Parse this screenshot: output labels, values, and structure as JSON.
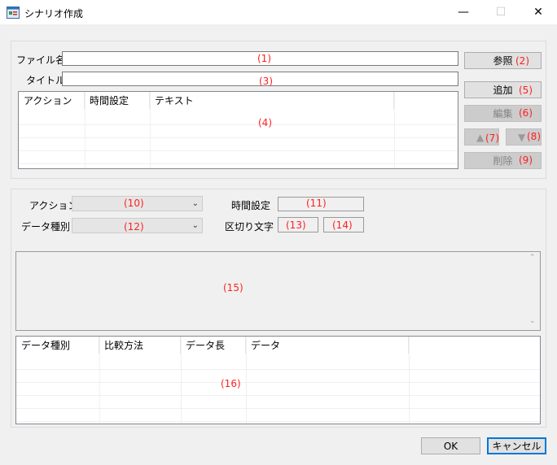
{
  "window": {
    "title": "シナリオ作成",
    "minimize_glyph": "—",
    "maximize_glyph": "☐",
    "close_glyph": "✕",
    "icon": "app-window-icon"
  },
  "top": {
    "filename_label": "ファイル名",
    "title_label": "タイトル",
    "browse_label": "参照",
    "add_label": "追加",
    "edit_label": "編集",
    "up_glyph": "▲",
    "down_glyph": "▼",
    "delete_label": "削除",
    "list_columns": [
      "アクション",
      "時間設定",
      "テキスト"
    ]
  },
  "bottom": {
    "action_label": "アクション",
    "time_label": "時間設定",
    "datatype_label": "データ種別",
    "delimiter_label": "区切り文字",
    "list_columns": [
      "データ種別",
      "比較方法",
      "データ長",
      "データ"
    ]
  },
  "footer": {
    "ok_label": "OK",
    "cancel_label": "キャンセル"
  },
  "annotations": {
    "n1": "(1)",
    "n2": "(2)",
    "n3": "(3)",
    "n4": "(4)",
    "n5": "(5)",
    "n6": "(6)",
    "n7": "(7)",
    "n8": "(8)",
    "n9": "(9)",
    "n10": "(10)",
    "n11": "(11)",
    "n12": "(12)",
    "n13": "(13)",
    "n14": "(14)",
    "n15": "(15)",
    "n16": "(16)"
  },
  "colors": {
    "annotation": "#ff2020",
    "accent": "#0078d7"
  }
}
